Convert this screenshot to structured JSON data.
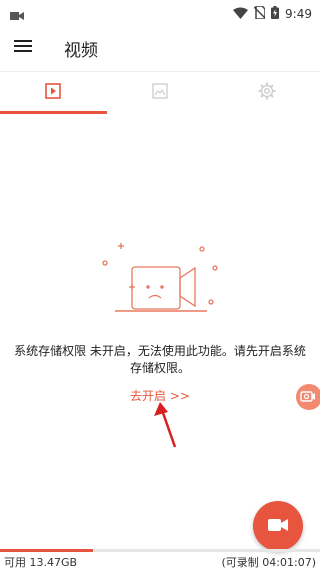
{
  "status_bar": {
    "time": "9:49",
    "icons": [
      "video-camera-icon",
      "wifi-icon",
      "no-sim-icon",
      "battery-charging-icon"
    ]
  },
  "app_bar": {
    "menu_icon": "hamburger-menu-icon",
    "title": "视频"
  },
  "tabs": [
    {
      "icon": "video-play-icon",
      "active": true
    },
    {
      "icon": "image-icon",
      "active": false
    },
    {
      "icon": "gear-icon",
      "active": false
    }
  ],
  "empty_state": {
    "illustration": "sad-camera-illustration",
    "message": "系统存储权限 未开启，无法使用此功能。请先开启系统存储权限。",
    "link": "去开启 >>"
  },
  "floating": {
    "side_button_icon": "camera-switch-icon",
    "record_button_icon": "video-camera-icon"
  },
  "storage": {
    "available": "可用 13.47GB",
    "recordable": "(可录制 04:01:07)",
    "used_fraction": 0.29
  },
  "colors": {
    "accent": "#e8553f",
    "accent_light": "#f28a72",
    "inactive_icon": "#cfcfcf"
  }
}
